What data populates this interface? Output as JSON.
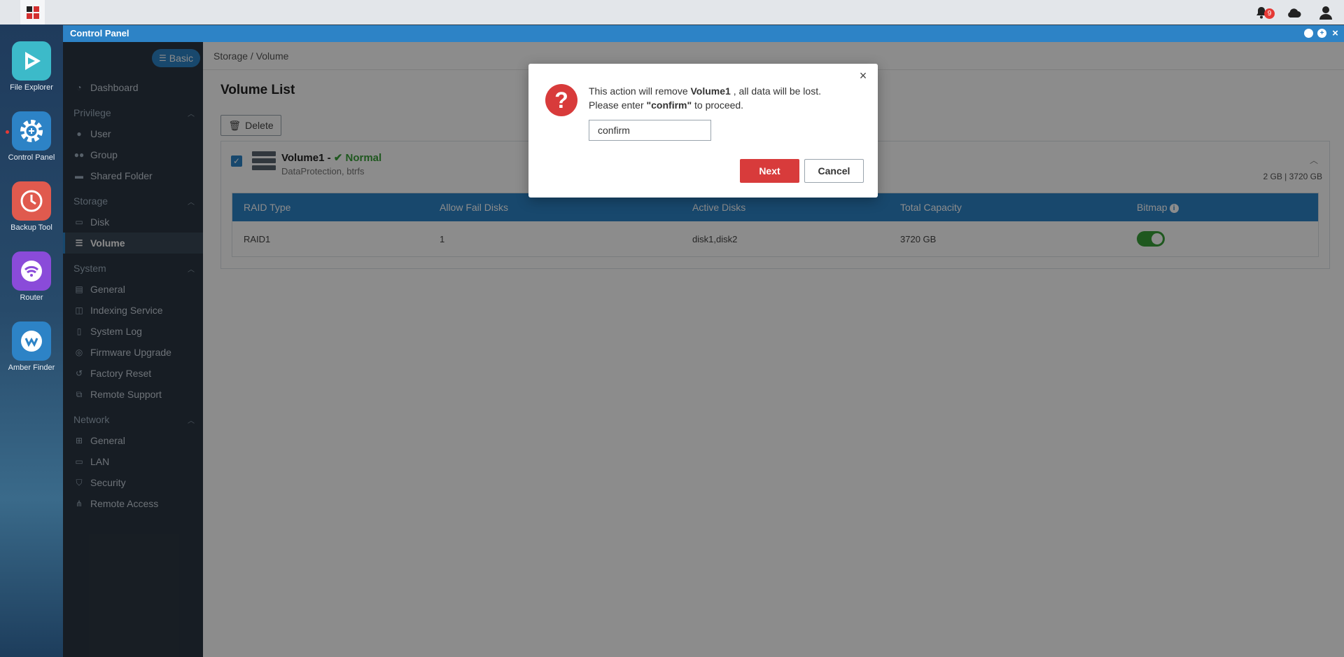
{
  "taskbar": {
    "notification_count": "9"
  },
  "desktop": {
    "apps": [
      {
        "label": "File Explorer",
        "color": "#3cbac9"
      },
      {
        "label": "Control Panel",
        "color": "#2d83c6"
      },
      {
        "label": "Backup Tool",
        "color": "#e05a4e"
      },
      {
        "label": "Router",
        "color": "#8a4bd9"
      },
      {
        "label": "Amber Finder",
        "color": "#2d83c6"
      }
    ]
  },
  "window": {
    "title": "Control Panel"
  },
  "sidebar": {
    "mode_button": "Basic",
    "dashboard": "Dashboard",
    "sections": {
      "privilege": "Privilege",
      "storage": "Storage",
      "system": "System",
      "network": "Network"
    },
    "items": {
      "user": "User",
      "group": "Group",
      "shared_folder": "Shared Folder",
      "disk": "Disk",
      "volume": "Volume",
      "general_system": "General",
      "indexing_service": "Indexing Service",
      "system_log": "System Log",
      "firmware_upgrade": "Firmware Upgrade",
      "factory_reset": "Factory Reset",
      "remote_support": "Remote Support",
      "general_network": "General",
      "lan": "LAN",
      "security": "Security",
      "remote_access": "Remote Access"
    }
  },
  "main": {
    "breadcrumb": "Storage / Volume",
    "title": "Volume List",
    "delete_button": "Delete",
    "volume": {
      "name": "Volume1 -",
      "status": "Normal",
      "subtitle": "DataProtection, btrfs",
      "capacity": "2 GB | 3720 GB"
    },
    "table": {
      "headers": [
        "RAID Type",
        "Allow Fail Disks",
        "Active Disks",
        "Total Capacity",
        "Bitmap"
      ],
      "row": [
        "RAID1",
        "1",
        "disk1,disk2",
        "3720 GB"
      ]
    }
  },
  "dialog": {
    "line1_pre": "This action will remove ",
    "line1_bold": "Volume1",
    "line1_post": " , all data will be lost.",
    "line2_pre": "Please enter ",
    "line2_bold": "\"confirm\"",
    "line2_post": " to proceed.",
    "input_value": "confirm",
    "next_button": "Next",
    "cancel_button": "Cancel"
  },
  "colors": {
    "accent": "#2d83c6",
    "danger": "#d83b3b",
    "success": "#3aa03a"
  }
}
